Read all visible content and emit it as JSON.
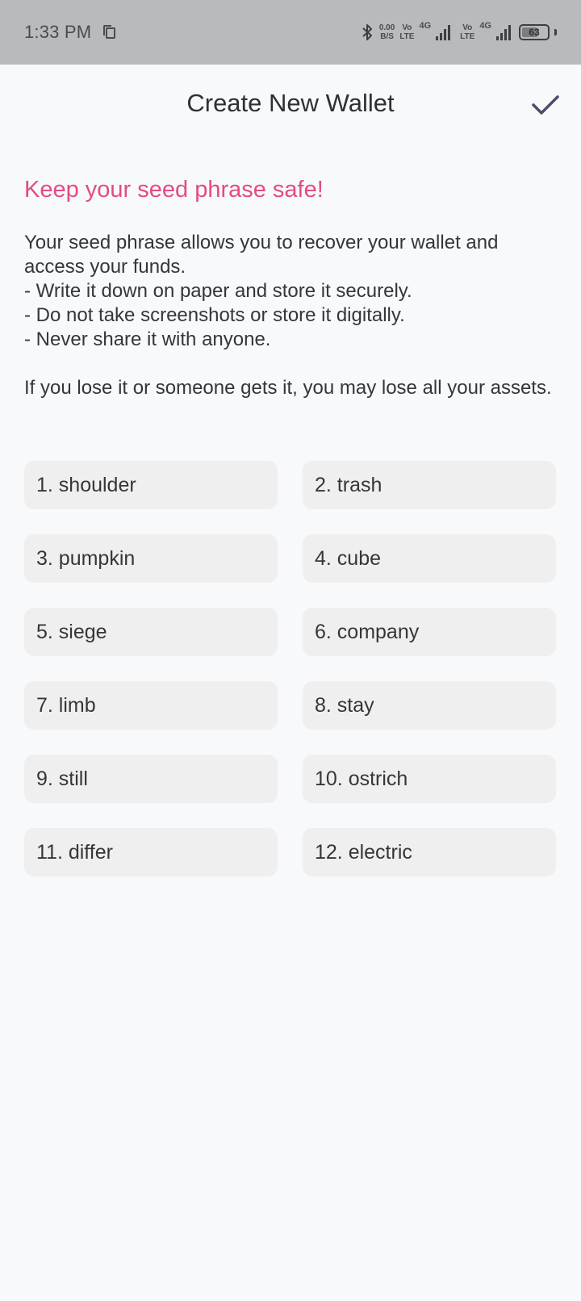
{
  "status_bar": {
    "time": "1:33 PM",
    "net_speed_value": "0.00",
    "net_speed_unit": "B/S",
    "sim1_vo": "Vo",
    "sim1_lte": "LTE",
    "sim1_net": "4G",
    "sim2_vo": "Vo",
    "sim2_lte": "LTE",
    "sim2_net": "4G",
    "battery_level": "63",
    "battery_fraction": 0.63
  },
  "app_bar": {
    "title": "Create New Wallet",
    "confirm_icon": "check-icon"
  },
  "warning": {
    "title": "Keep your seed phrase safe!",
    "body": "Your seed phrase allows you to recover your wallet and access your funds.\n- Write it down on paper and store it securely.\n- Do not take screenshots or store it digitally.\n- Never share it with anyone.\n\nIf you lose it or someone gets it, you may lose all your assets."
  },
  "seed_words": [
    "1. shoulder",
    "2. trash",
    "3. pumpkin",
    "4. cube",
    "5. siege",
    "6. company",
    "7. limb",
    "8. stay",
    "9. still",
    "10. ostrich",
    "11. differ",
    "12. electric"
  ],
  "colors": {
    "status_bar_bg": "#b9babc",
    "page_bg": "#f8f9fb",
    "accent_pink": "#e34b86",
    "chip_bg": "#efefef",
    "check_color": "#4c4d66"
  }
}
